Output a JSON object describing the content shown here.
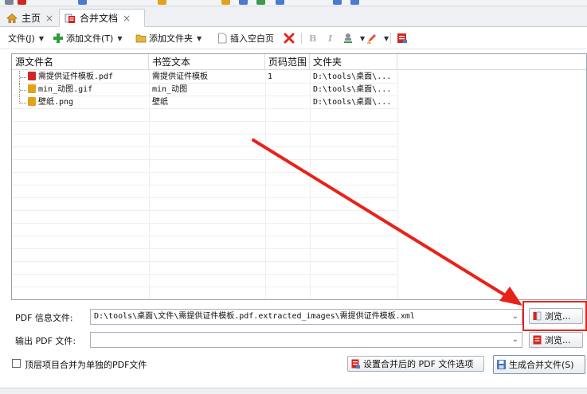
{
  "tabs": [
    {
      "label": "主页"
    },
    {
      "label": "合并文档"
    }
  ],
  "toolbar": {
    "file_menu": "文件(J)",
    "add_file": "添加文件(T)",
    "add_folder": "添加文件夹",
    "insert_blank": "插入空白页",
    "bold": "B",
    "italic": "I"
  },
  "list": {
    "headers": [
      "源文件名",
      "书签文本",
      "页码范围",
      "文件夹"
    ],
    "rows": [
      {
        "name": "需提供证件模板.pdf",
        "bookmark": "需提供证件模板",
        "pages": "1",
        "folder": "D:\\tools\\桌面\\..."
      },
      {
        "name": "min_动图.gif",
        "bookmark": "min_动图",
        "pages": "",
        "folder": "D:\\tools\\桌面\\..."
      },
      {
        "name": "壁纸.png",
        "bookmark": "壁纸",
        "pages": "",
        "folder": "D:\\tools\\桌面\\..."
      }
    ]
  },
  "form": {
    "pdf_info_label": "PDF 信息文件:",
    "pdf_info_value": "D:\\tools\\桌面\\文件\\需提供证件模板.pdf.extracted_images\\需提供证件模板.xml",
    "output_label": "输出 PDF 文件:",
    "output_value": "",
    "browse_label": "浏览...",
    "merge_top_checkbox": "顶层项目合并为单独的PDF文件",
    "options_button": "设置合并后的 PDF 文件选项",
    "generate_button": "生成合并文件(S)"
  },
  "colors": {
    "annotation_red": "#e8221b",
    "accent_green": "#2e9e3a",
    "pdf_red": "#d2281f"
  }
}
